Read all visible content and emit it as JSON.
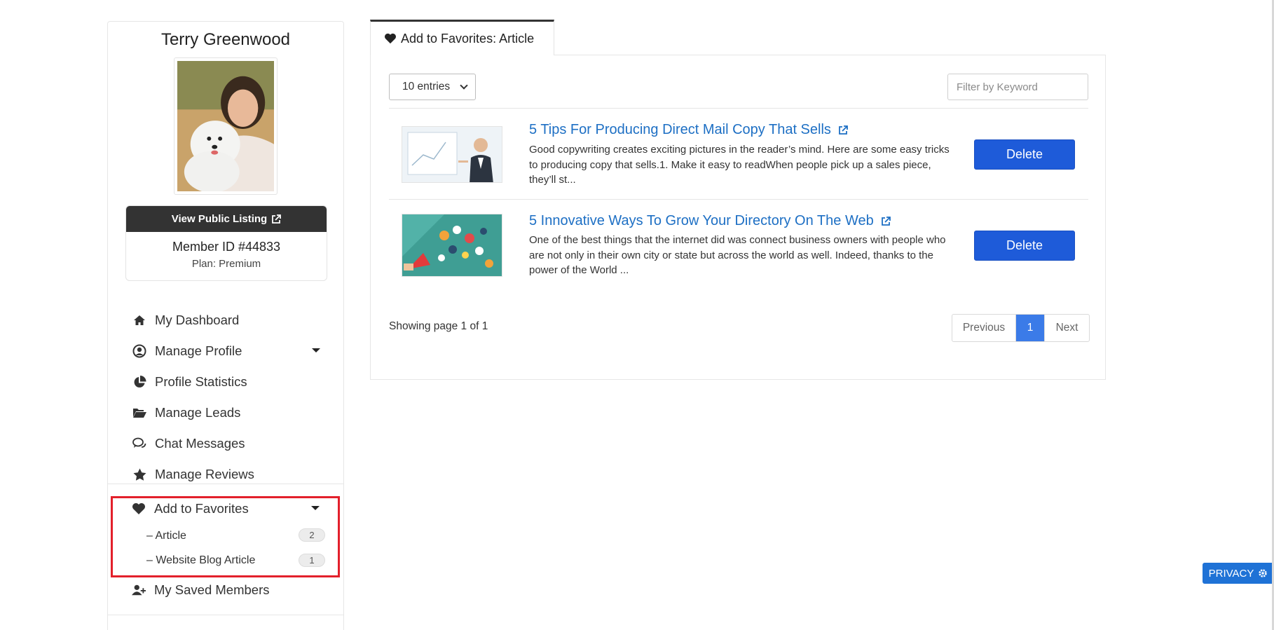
{
  "sidebar": {
    "member_name": "Terry Greenwood",
    "view_listing_label": "View Public Listing",
    "member_id": "Member ID #44833",
    "plan": "Plan: Premium",
    "nav": [
      {
        "label": "My Dashboard",
        "icon": "home-icon"
      },
      {
        "label": "Manage Profile",
        "icon": "user-circle-icon"
      },
      {
        "label": "Profile Statistics",
        "icon": "pie-chart-icon"
      },
      {
        "label": "Manage Leads",
        "icon": "folder-open-icon"
      },
      {
        "label": "Chat Messages",
        "icon": "chat-icon"
      },
      {
        "label": "Manage Reviews",
        "icon": "star-icon"
      }
    ],
    "favorites": {
      "label": "Add to Favorites",
      "items": [
        {
          "label": "– Article",
          "count": "2"
        },
        {
          "label": "– Website Blog Article",
          "count": "1"
        }
      ]
    },
    "saved_members_label": "My Saved Members"
  },
  "main": {
    "tab_label": "Add to Favorites: Article",
    "entries_selected": "10 entries",
    "filter_placeholder": "Filter by Keyword",
    "articles": [
      {
        "title": "5 Tips For Producing Direct Mail Copy That Sells",
        "excerpt": "Good copywriting creates exciting pictures in the reader’s mind. Here are some easy tricks to producing copy that sells.1. Make it easy to readWhen people pick up a sales piece, they’ll st...",
        "delete_label": "Delete"
      },
      {
        "title": "5 Innovative Ways To Grow Your Directory On The Web",
        "excerpt": "One of the best things that the internet did was connect business owners with people who are not only in their own city or state but across the world as well. Indeed, thanks to the power of the World ...",
        "delete_label": "Delete"
      }
    ],
    "showing_text": "Showing page 1 of 1",
    "pagination": {
      "previous": "Previous",
      "current": "1",
      "next": "Next"
    }
  },
  "privacy_label": "PRIVACY",
  "colors": {
    "link": "#1d6fc4",
    "primary_button": "#1e5bd9",
    "highlight_border": "#e3202b",
    "privacy": "#1f72d6"
  }
}
